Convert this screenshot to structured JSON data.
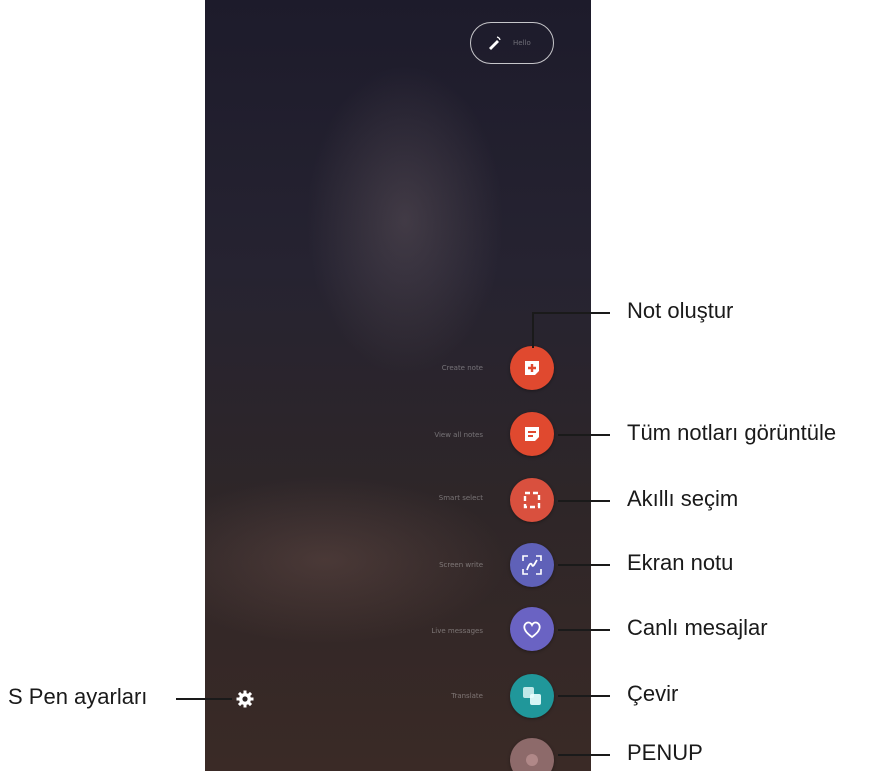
{
  "screen": {
    "pen_pill_text": "Hello",
    "menu_items": [
      {
        "label": "Create note",
        "callout": "Not oluştur",
        "color": "#e0492f",
        "icon": "create-note-icon"
      },
      {
        "label": "View all notes",
        "callout": "Tüm notları görüntüle",
        "color": "#e0492f",
        "icon": "view-all-notes-icon"
      },
      {
        "label": "Smart select",
        "callout": "Akıllı seçim",
        "color": "#d9503e",
        "icon": "smart-select-icon"
      },
      {
        "label": "Screen write",
        "callout": "Ekran notu",
        "color": "#5f61b8",
        "icon": "screen-write-icon"
      },
      {
        "label": "Live messages",
        "callout": "Canlı mesajlar",
        "color": "#6a63c3",
        "icon": "live-messages-icon"
      },
      {
        "label": "Translate",
        "callout": "Çevir",
        "color": "#20979a",
        "icon": "translate-icon"
      },
      {
        "label": "PENUP",
        "callout": "PENUP",
        "color": "#8d6a6a",
        "icon": "penup-icon"
      }
    ],
    "settings_callout": "S Pen ayarları"
  }
}
